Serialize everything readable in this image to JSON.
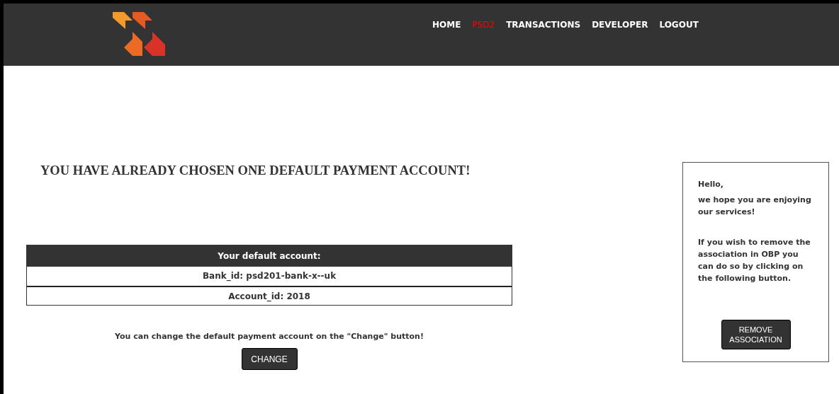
{
  "nav": [
    {
      "label": "HOME",
      "selected": false
    },
    {
      "label": "PSD2",
      "selected": true
    },
    {
      "label": "TRANSACTIONS",
      "selected": false
    },
    {
      "label": "DEVELOPER",
      "selected": false
    },
    {
      "label": "LOGOUT",
      "selected": false
    }
  ],
  "heading": "YOU HAVE ALREADY CHOSEN ONE DEFAULT PAYMENT ACCOUNT!",
  "account_table": {
    "header": "Your default account:",
    "rows": [
      "Bank_id: psd201-bank-x--uk",
      "Account_id: 2018"
    ]
  },
  "change_hint": "You can change the default payment account on the \"Change\" button!",
  "change_button": "CHANGE",
  "side_card": {
    "greeting": "Hello,",
    "paragraphs": [
      "we hope you are enjoying our services!",
      "If you wish to remove the association in OBP you can do so by clicking on the following button."
    ],
    "button": "REMOVE ASSOCIATION"
  }
}
